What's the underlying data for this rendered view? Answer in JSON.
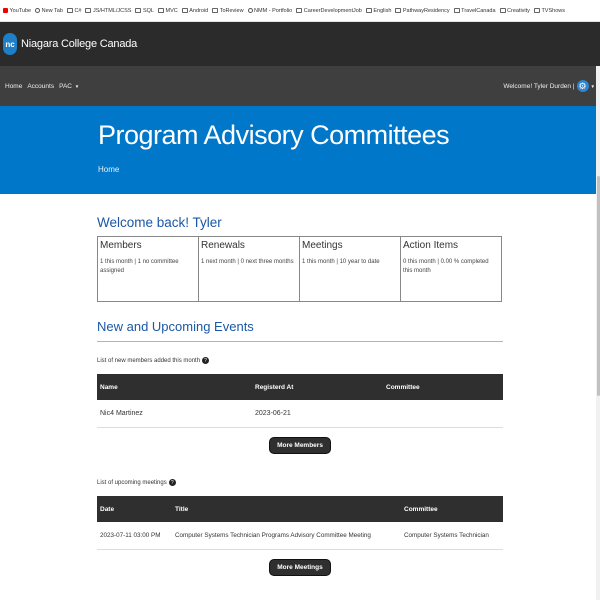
{
  "bookmarks": [
    {
      "label": "YouTube",
      "icon": "youtube-icon"
    },
    {
      "label": "New Tab",
      "icon": "globe-icon"
    },
    {
      "label": "C#",
      "icon": "folder-icon"
    },
    {
      "label": "JS/HTML/JCSS",
      "icon": "folder-icon"
    },
    {
      "label": "SQL",
      "icon": "folder-icon"
    },
    {
      "label": "MVC",
      "icon": "folder-icon"
    },
    {
      "label": "Android",
      "icon": "folder-icon"
    },
    {
      "label": "ToReview",
      "icon": "folder-icon"
    },
    {
      "label": "NMM - Portfolio",
      "icon": "globe-icon"
    },
    {
      "label": "CareerDevelopmentJob",
      "icon": "folder-icon"
    },
    {
      "label": "English",
      "icon": "folder-icon"
    },
    {
      "label": "PathwayResidency",
      "icon": "folder-icon"
    },
    {
      "label": "TravelCanada",
      "icon": "folder-icon"
    },
    {
      "label": "Creativity",
      "icon": "folder-icon"
    },
    {
      "label": "TVShows",
      "icon": "folder-icon"
    }
  ],
  "brand": {
    "logo_text": "nc",
    "name": "Niagara College Canada"
  },
  "nav": {
    "home": "Home",
    "accounts": "Accounts",
    "pac": "PAC",
    "caret": "▼",
    "welcome": "Welcome! Tyler Durden |",
    "gear_icon": "gear-icon"
  },
  "hero": {
    "title": "Program Advisory Committees",
    "breadcrumb": "Home"
  },
  "welcome": "Welcome back! Tyler",
  "stats": [
    {
      "title": "Members",
      "detail": "1 this month | 1 no committee assigned"
    },
    {
      "title": "Renewals",
      "detail": "1 next month | 0 next three months"
    },
    {
      "title": "Meetings",
      "detail": "1 this month | 10 year to date"
    },
    {
      "title": "Action Items",
      "detail": "0 this month | 0.00 % completed this month"
    }
  ],
  "events": {
    "heading": "New and Upcoming Events",
    "members_caption": "List of new members added this month",
    "help_glyph": "?",
    "members_headers": [
      "Name",
      "Registerd At",
      "Committee"
    ],
    "members_rows": [
      {
        "name": "Nic4 Martinez",
        "registered": "2023-06-21",
        "committee": ""
      }
    ],
    "more_members": "More Members",
    "meetings_caption": "List of upcoming meetings",
    "meetings_headers": [
      "Date",
      "Title",
      "Committee"
    ],
    "meetings_rows": [
      {
        "date": "2023-07-11 03:00 PM",
        "title": "Computer Systems Technician Programs Advisory Committee Meeting",
        "committee": "Computer Systems Technician"
      }
    ],
    "more_meetings": "More Meetings"
  },
  "colors": {
    "brand_bar": "#2b2b2b",
    "nav_bar": "#3f3f3f",
    "hero": "#0077c8",
    "heading": "#1a57a8",
    "table_header": "#2f2f2f"
  }
}
